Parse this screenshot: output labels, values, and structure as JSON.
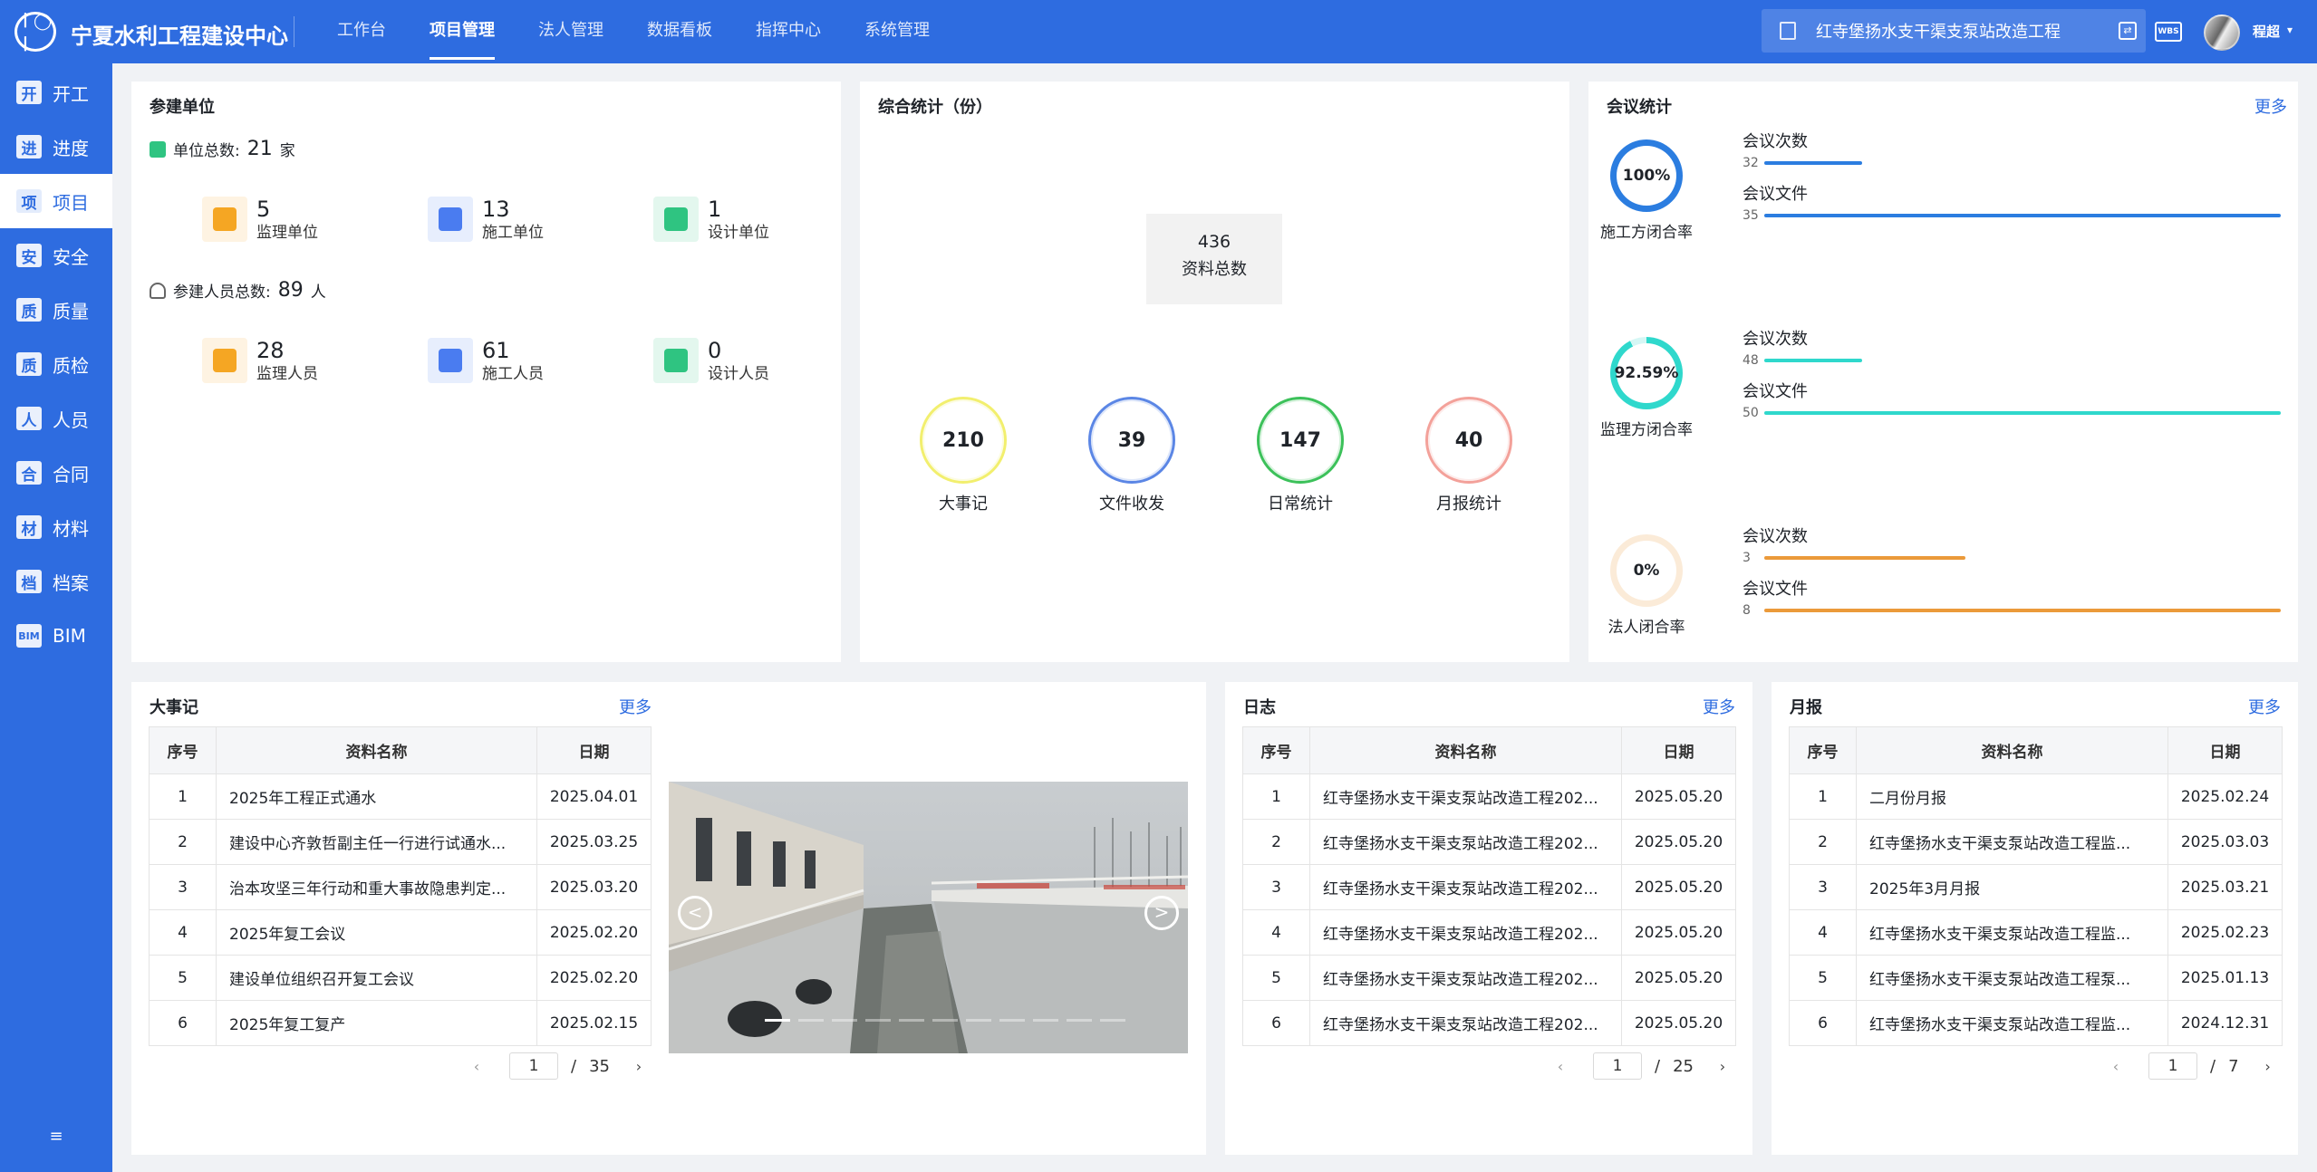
{
  "app": {
    "title": "宁夏水利工程建设中心",
    "logo_icon": "water-logo-icon"
  },
  "nav": [
    "工作台",
    "项目管理",
    "法人管理",
    "数据看板",
    "指挥中心",
    "系统管理"
  ],
  "nav_active": "项目管理",
  "header": {
    "project_name": "红寺堡扬水支干渠支泵站改造工程",
    "wbs_label": "WBS",
    "username": "程超"
  },
  "sidebar": {
    "items": [
      {
        "icon": "开",
        "label": "开工"
      },
      {
        "icon": "进",
        "label": "进度"
      },
      {
        "icon": "项",
        "label": "项目"
      },
      {
        "icon": "安",
        "label": "安全"
      },
      {
        "icon": "质",
        "label": "质量"
      },
      {
        "icon": "质",
        "label": "质检"
      },
      {
        "icon": "人",
        "label": "人员"
      },
      {
        "icon": "合",
        "label": "合同"
      },
      {
        "icon": "材",
        "label": "材料"
      },
      {
        "icon": "档",
        "label": "档案"
      },
      {
        "icon": "BIM",
        "label": "BIM"
      }
    ],
    "active": "项目"
  },
  "participants": {
    "title": "参建单位",
    "unit_total_label": "单位总数:",
    "unit_total": "21",
    "unit_suffix": "家",
    "units": [
      {
        "count": "5",
        "label": "监理单位",
        "color": "#f5a623"
      },
      {
        "count": "13",
        "label": "施工单位",
        "color": "#4a7cf0"
      },
      {
        "count": "1",
        "label": "设计单位",
        "color": "#2fc481"
      }
    ],
    "people_total_label": "参建人员总数:",
    "people_total": "89",
    "people_suffix": "人",
    "people": [
      {
        "count": "28",
        "label": "监理人员",
        "color": "#f5a623"
      },
      {
        "count": "61",
        "label": "施工人员",
        "color": "#4a7cf0"
      },
      {
        "count": "0",
        "label": "设计人员",
        "color": "#2fc481"
      }
    ]
  },
  "comprehensive": {
    "title": "综合统计（份）",
    "total": "436",
    "total_label": "资料总数",
    "items": [
      {
        "value": "210",
        "label": "大事记",
        "color": "#f2ef6e"
      },
      {
        "value": "39",
        "label": "文件收发",
        "color": "#5b86e5"
      },
      {
        "value": "147",
        "label": "日常统计",
        "color": "#3cc15a"
      },
      {
        "value": "40",
        "label": "月报统计",
        "color": "#f3a19a"
      }
    ]
  },
  "meetings": {
    "title": "会议统计",
    "more": "更多",
    "count_label": "会议次数",
    "file_label": "会议文件",
    "groups": [
      {
        "rate_text": "100%",
        "rate": 1.0,
        "label": "施工方闭合率",
        "color": "#2b7de0",
        "count": "32",
        "files": "35",
        "count_fill": 0.19,
        "file_fill": 1.0
      },
      {
        "rate_text": "92.59%",
        "rate": 0.9259,
        "label": "监理方闭合率",
        "color": "#2fd8cc",
        "count": "48",
        "files": "50",
        "count_fill": 0.19,
        "file_fill": 1.0
      },
      {
        "rate_text": "0%",
        "rate": 0.0,
        "label": "法人闭合率",
        "color": "#eb9a3a",
        "count": "3",
        "files": "8",
        "count_fill": 0.39,
        "file_fill": 1.0
      }
    ]
  },
  "events": {
    "title": "大事记",
    "more": "更多",
    "columns": [
      "序号",
      "资料名称",
      "日期"
    ],
    "rows": [
      [
        "1",
        "2025年工程正式通水",
        "2025.04.01"
      ],
      [
        "2",
        "建设中心齐敦哲副主任一行进行试通水...",
        "2025.03.25"
      ],
      [
        "3",
        "治本攻坚三年行动和重大事故隐患判定...",
        "2025.03.20"
      ],
      [
        "4",
        "2025年复工会议",
        "2025.02.20"
      ],
      [
        "5",
        "建设单位组织召开复工会议",
        "2025.02.20"
      ],
      [
        "6",
        "2025年复工复产",
        "2025.02.15"
      ]
    ],
    "page": "1",
    "total_pages": "35"
  },
  "carousel": {
    "slide_count": 11,
    "active_index": 0
  },
  "log": {
    "title": "日志",
    "more": "更多",
    "columns": [
      "序号",
      "资料名称",
      "日期"
    ],
    "rows": [
      [
        "1",
        "红寺堡扬水支干渠支泵站改造工程202...",
        "2025.05.20"
      ],
      [
        "2",
        "红寺堡扬水支干渠支泵站改造工程202...",
        "2025.05.20"
      ],
      [
        "3",
        "红寺堡扬水支干渠支泵站改造工程202...",
        "2025.05.20"
      ],
      [
        "4",
        "红寺堡扬水支干渠支泵站改造工程202...",
        "2025.05.20"
      ],
      [
        "5",
        "红寺堡扬水支干渠支泵站改造工程202...",
        "2025.05.20"
      ],
      [
        "6",
        "红寺堡扬水支干渠支泵站改造工程202...",
        "2025.05.20"
      ]
    ],
    "page": "1",
    "total_pages": "25"
  },
  "monthly": {
    "title": "月报",
    "more": "更多",
    "columns": [
      "序号",
      "资料名称",
      "日期"
    ],
    "rows": [
      [
        "1",
        "二月份月报",
        "2025.02.24"
      ],
      [
        "2",
        "红寺堡扬水支干渠支泵站改造工程监...",
        "2025.03.03"
      ],
      [
        "3",
        "2025年3月月报",
        "2025.03.21"
      ],
      [
        "4",
        "红寺堡扬水支干渠支泵站改造工程监...",
        "2025.02.23"
      ],
      [
        "5",
        "红寺堡扬水支干渠支泵站改造工程泵...",
        "2025.01.13"
      ],
      [
        "6",
        "红寺堡扬水支干渠支泵站改造工程监...",
        "2024.12.31"
      ]
    ],
    "page": "1",
    "total_pages": "7"
  }
}
